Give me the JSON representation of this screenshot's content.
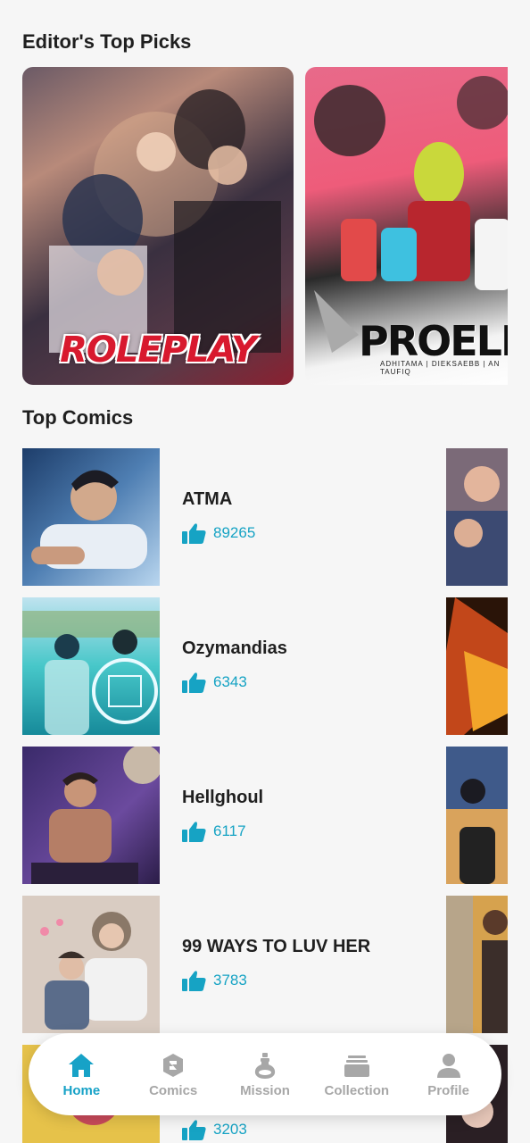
{
  "editors_picks": {
    "title": "Editor's Top Picks",
    "cards": [
      {
        "logo": "ROLEPLAY"
      },
      {
        "logo": "PROELIUM",
        "credits": "ADHITAMA | DIEKSAEBB | AN TAUFIQ"
      }
    ]
  },
  "top_comics": {
    "title": "Top Comics",
    "items": [
      {
        "title": "ATMA",
        "likes": "89265"
      },
      {
        "title": "Ozymandias",
        "likes": "6343"
      },
      {
        "title": "Hellghoul",
        "likes": "6117"
      },
      {
        "title": "99 WAYS TO LUV HER",
        "likes": "3783"
      },
      {
        "title": "",
        "likes": "3203"
      }
    ]
  },
  "tabbar": {
    "tabs": [
      {
        "label": "Home",
        "icon": "home-icon",
        "active": true
      },
      {
        "label": "Comics",
        "icon": "comics-icon",
        "active": false
      },
      {
        "label": "Mission",
        "icon": "mission-icon",
        "active": false
      },
      {
        "label": "Collection",
        "icon": "collection-icon",
        "active": false
      },
      {
        "label": "Profile",
        "icon": "profile-icon",
        "active": false
      }
    ]
  },
  "colors": {
    "accent": "#17a2c7",
    "inactive": "#a7a7a7",
    "text": "#1f1f1f",
    "background": "#f6f6f6"
  }
}
